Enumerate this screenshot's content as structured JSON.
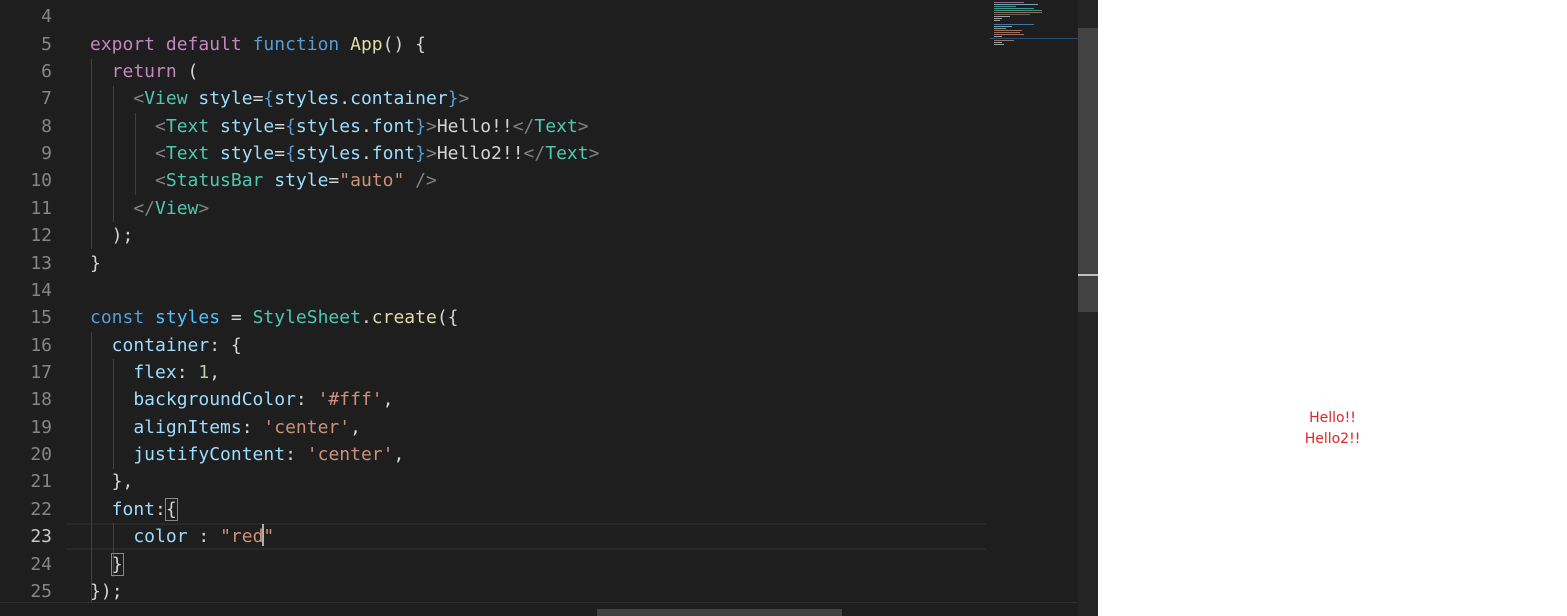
{
  "editor": {
    "active_line": 23,
    "lines": [
      {
        "num": "4",
        "tokens": []
      },
      {
        "num": "5",
        "tokens": [
          {
            "t": "export ",
            "c": "kw"
          },
          {
            "t": "default ",
            "c": "kw"
          },
          {
            "t": "function ",
            "c": "kb"
          },
          {
            "t": "App",
            "c": "fn"
          },
          {
            "t": "() ",
            "c": "pn"
          },
          {
            "t": "{",
            "c": "pn"
          }
        ]
      },
      {
        "num": "6",
        "tokens": [
          {
            "t": "  return ",
            "c": "kw"
          },
          {
            "t": "(",
            "c": "pn"
          }
        ]
      },
      {
        "num": "7",
        "tokens": [
          {
            "t": "    <",
            "c": "br"
          },
          {
            "t": "View ",
            "c": "tg"
          },
          {
            "t": "style",
            "c": "at"
          },
          {
            "t": "=",
            "c": "pn"
          },
          {
            "t": "{",
            "c": "kb"
          },
          {
            "t": "styles",
            "c": "at"
          },
          {
            "t": ".",
            "c": "pn"
          },
          {
            "t": "container",
            "c": "at"
          },
          {
            "t": "}",
            "c": "kb"
          },
          {
            "t": ">",
            "c": "br"
          }
        ]
      },
      {
        "num": "8",
        "tokens": [
          {
            "t": "      <",
            "c": "br"
          },
          {
            "t": "Text ",
            "c": "tg"
          },
          {
            "t": "style",
            "c": "at"
          },
          {
            "t": "=",
            "c": "pn"
          },
          {
            "t": "{",
            "c": "kb"
          },
          {
            "t": "styles",
            "c": "at"
          },
          {
            "t": ".",
            "c": "pn"
          },
          {
            "t": "font",
            "c": "at"
          },
          {
            "t": "}",
            "c": "kb"
          },
          {
            "t": ">",
            "c": "br"
          },
          {
            "t": "Hello!!",
            "c": "pn"
          },
          {
            "t": "</",
            "c": "br"
          },
          {
            "t": "Text",
            "c": "tg"
          },
          {
            "t": ">",
            "c": "br"
          }
        ]
      },
      {
        "num": "9",
        "tokens": [
          {
            "t": "      <",
            "c": "br"
          },
          {
            "t": "Text ",
            "c": "tg"
          },
          {
            "t": "style",
            "c": "at"
          },
          {
            "t": "=",
            "c": "pn"
          },
          {
            "t": "{",
            "c": "kb"
          },
          {
            "t": "styles",
            "c": "at"
          },
          {
            "t": ".",
            "c": "pn"
          },
          {
            "t": "font",
            "c": "at"
          },
          {
            "t": "}",
            "c": "kb"
          },
          {
            "t": ">",
            "c": "br"
          },
          {
            "t": "Hello2!!",
            "c": "pn"
          },
          {
            "t": "</",
            "c": "br"
          },
          {
            "t": "Text",
            "c": "tg"
          },
          {
            "t": ">",
            "c": "br"
          }
        ]
      },
      {
        "num": "10",
        "tokens": [
          {
            "t": "      <",
            "c": "br"
          },
          {
            "t": "StatusBar ",
            "c": "tg"
          },
          {
            "t": "style",
            "c": "at"
          },
          {
            "t": "=",
            "c": "pn"
          },
          {
            "t": "\"auto\"",
            "c": "st"
          },
          {
            "t": " />",
            "c": "br"
          }
        ]
      },
      {
        "num": "11",
        "tokens": [
          {
            "t": "    </",
            "c": "br"
          },
          {
            "t": "View",
            "c": "tg"
          },
          {
            "t": ">",
            "c": "br"
          }
        ]
      },
      {
        "num": "12",
        "tokens": [
          {
            "t": "  )",
            "c": "pn"
          },
          {
            "t": ";",
            "c": "pn"
          }
        ]
      },
      {
        "num": "13",
        "tokens": [
          {
            "t": "}",
            "c": "pn"
          }
        ]
      },
      {
        "num": "14",
        "tokens": []
      },
      {
        "num": "15",
        "tokens": [
          {
            "t": "const ",
            "c": "kb"
          },
          {
            "t": "styles ",
            "c": "va"
          },
          {
            "t": "= ",
            "c": "pn"
          },
          {
            "t": "StyleSheet",
            "c": "tg"
          },
          {
            "t": ".",
            "c": "pn"
          },
          {
            "t": "create",
            "c": "fn"
          },
          {
            "t": "(",
            "c": "pn"
          },
          {
            "t": "{",
            "c": "pn"
          }
        ]
      },
      {
        "num": "16",
        "tokens": [
          {
            "t": "  container",
            "c": "at"
          },
          {
            "t": ": ",
            "c": "pn"
          },
          {
            "t": "{",
            "c": "pn"
          }
        ]
      },
      {
        "num": "17",
        "tokens": [
          {
            "t": "    flex",
            "c": "at"
          },
          {
            "t": ": ",
            "c": "pn"
          },
          {
            "t": "1",
            "c": "nu"
          },
          {
            "t": ",",
            "c": "pn"
          }
        ]
      },
      {
        "num": "18",
        "tokens": [
          {
            "t": "    backgroundColor",
            "c": "at"
          },
          {
            "t": ": ",
            "c": "pn"
          },
          {
            "t": "'#fff'",
            "c": "st"
          },
          {
            "t": ",",
            "c": "pn"
          }
        ]
      },
      {
        "num": "19",
        "tokens": [
          {
            "t": "    alignItems",
            "c": "at"
          },
          {
            "t": ": ",
            "c": "pn"
          },
          {
            "t": "'center'",
            "c": "st"
          },
          {
            "t": ",",
            "c": "pn"
          }
        ]
      },
      {
        "num": "20",
        "tokens": [
          {
            "t": "    justifyContent",
            "c": "at"
          },
          {
            "t": ": ",
            "c": "pn"
          },
          {
            "t": "'center'",
            "c": "st"
          },
          {
            "t": ",",
            "c": "pn"
          }
        ]
      },
      {
        "num": "21",
        "tokens": [
          {
            "t": "  }",
            "c": "pn"
          },
          {
            "t": ",",
            "c": "pn"
          }
        ]
      },
      {
        "num": "22",
        "tokens": [
          {
            "t": "  font",
            "c": "at"
          },
          {
            "t": ":",
            "c": "pn"
          },
          {
            "t": "{",
            "c": "pn",
            "hl": true
          }
        ]
      },
      {
        "num": "23",
        "tokens": [
          {
            "t": "    color ",
            "c": "at"
          },
          {
            "t": ": ",
            "c": "pn"
          },
          {
            "t": "\"red",
            "c": "st",
            "cursor_after": true
          },
          {
            "t": "\"",
            "c": "st"
          }
        ]
      },
      {
        "num": "24",
        "tokens": [
          {
            "t": "  ",
            "c": "pn"
          },
          {
            "t": "}",
            "c": "pn",
            "hl": true
          }
        ]
      },
      {
        "num": "25",
        "tokens": [
          {
            "t": "}",
            "c": "pn"
          },
          {
            "t": ")",
            "c": "pn"
          },
          {
            "t": ";",
            "c": "pn"
          }
        ]
      }
    ]
  },
  "preview": {
    "text_color": "#e02424",
    "lines": [
      "Hello!!",
      "Hello2!!"
    ]
  }
}
